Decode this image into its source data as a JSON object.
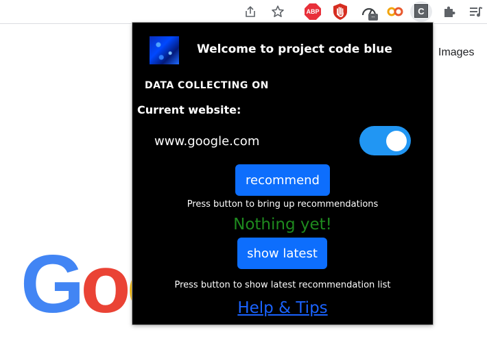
{
  "browser": {
    "google_images_label": "Images",
    "google_logo_letters": [
      "G",
      "o",
      "o"
    ],
    "extensions": {
      "abp_label": "ABP",
      "speed_badge": "--",
      "active_ext_label": "C"
    },
    "icons": {
      "share": "share-icon",
      "bookmark": "star-icon",
      "extensions": "puzzle-icon",
      "reading_list": "reading-list-icon"
    }
  },
  "popup": {
    "title": "Welcome to project code blue",
    "status": "DATA COLLECTING ON",
    "current_label": "Current website:",
    "current_site": "www.google.com",
    "toggle_on": true,
    "recommend_button": "recommend",
    "recommend_hint": "Press button to bring up recommendations",
    "recommendation_result": "Nothing yet!",
    "latest_button": "show latest",
    "latest_hint": "Press button to show latest recommendation list",
    "help_link": "Help & Tips",
    "colors": {
      "background": "#000000",
      "button": "#0d6efd",
      "toggle": "#2196f3",
      "result": "#1e8a1e",
      "link": "#1a63ff"
    }
  }
}
